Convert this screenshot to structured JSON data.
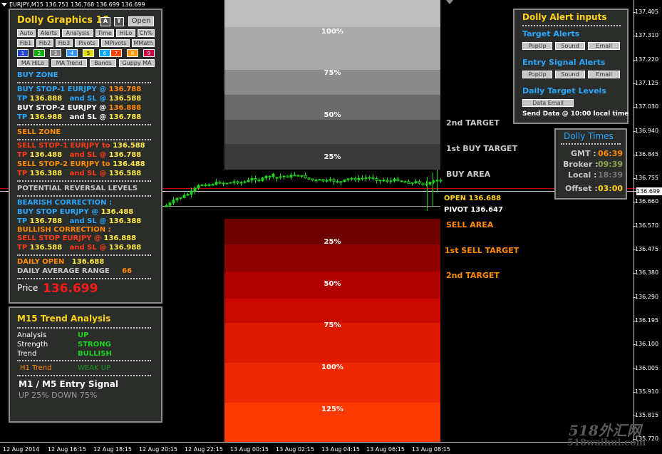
{
  "chart": {
    "title": "EURJPY,M15  136.751 136.768 136.699 136.699",
    "current_price_tag": "136.699",
    "price_ticks": [
      "137.405",
      "137.310",
      "137.220",
      "137.125",
      "137.030",
      "136.940",
      "136.845",
      "136.755",
      "136.660",
      "136.570",
      "136.475",
      "136.380",
      "136.290",
      "136.195",
      "136.100",
      "136.005",
      "135.910",
      "135.815",
      "135.720"
    ],
    "time_ticks": [
      "12 Aug 2014",
      "12 Aug 16:15",
      "12 Aug 18:15",
      "12 Aug 20:15",
      "12 Aug 22:15",
      "13 Aug 00:15",
      "13 Aug 02:15",
      "13 Aug 04:15",
      "13 Aug 06:15",
      "13 Aug 08:15"
    ],
    "grey_zone_labels": [
      "100%",
      "75%",
      "50%",
      "25%"
    ],
    "red_zone_labels": [
      "25%",
      "50%",
      "75%",
      "100%",
      "125%"
    ],
    "side_labels": {
      "second_target_up": "2nd TARGET",
      "first_buy_target": "1st BUY TARGET",
      "buy_area": "BUY AREA",
      "open": "OPEN 136.688",
      "pivot": "PIVOT 136.647",
      "sell_area": "SELL AREA",
      "first_sell_target": "1st SELL TARGET",
      "second_target_down": "2nd TARGET"
    },
    "watermark": "518外汇网",
    "watermark_url": "518waihui.com"
  },
  "main_panel": {
    "title": "Dolly Graphics 16",
    "btn_a": "A",
    "btn_t": "T",
    "btn_open": "Open",
    "row1": [
      "Auto",
      "Alerts",
      "Analysis",
      "Time",
      "HiLo",
      "Ch%"
    ],
    "row2": [
      "Fib1",
      "Fib2",
      "Fib3",
      "Pivots",
      "MPivots",
      "MMath"
    ],
    "row3": [
      "1",
      "2",
      "3",
      "4",
      "5",
      "6",
      "7",
      "8",
      "9"
    ],
    "row4": [
      "MA HiLo",
      "MA Trend",
      "Bands",
      "Guppy MA"
    ],
    "buy_zone": "BUY ZONE",
    "buy_stop1_a": "BUY STOP-1  EURJPY  @",
    "buy_stop1_v": "136.788",
    "tp1_a": "TP",
    "tp1_v": "136.888",
    "tp1_b": "and SL @",
    "tp1_sl": "136.588",
    "buy_stop2_a": "BUY STOP-2  EURJPY  @",
    "buy_stop2_v": "136.888",
    "tp2_a": "TP",
    "tp2_v": "136.988",
    "tp2_b": "and SL @",
    "tp2_sl": "136.788",
    "sell_zone": "SELL ZONE",
    "sell_stop1_a": "SELL STOP-1  EURJPY to",
    "sell_stop1_v": "136.588",
    "stp1_a": "TP",
    "stp1_v": "136.488",
    "stp1_b": "and SL @",
    "stp1_sl": "136.788",
    "sell_stop2_a": "SELL STOP-2  EURJPY to",
    "sell_stop2_v": "136.488",
    "stp2_a": "TP",
    "stp2_v": "136.388",
    "stp2_b": "and SL @",
    "stp2_sl": "136.588",
    "potential": "POTENTIAL REVERSAL LEVELS",
    "bearish": "BEARISH CORRECTION :",
    "bear_stop_a": "BUY STOP EURJPY  @",
    "bear_stop_v": "136.488",
    "bear_tp_a": "TP",
    "bear_tp_v": "136.788",
    "bear_tp_b": "and SL @",
    "bear_tp_sl": "136.388",
    "bullish": "BULLISH CORRECTION :",
    "bull_stop_a": "SELL STOP EURJPY  @",
    "bull_stop_v": "136.888",
    "bull_tp_a": "TP",
    "bull_tp_v": "136.588",
    "bull_tp_b": "and SL @",
    "bull_tp_sl": "136.988",
    "daily_open_a": "DAILY OPEN",
    "daily_open_v": "136.688",
    "dar_a": "DAILY AVERAGE RANGE",
    "dar_v": "66",
    "price_label": "Price",
    "price_value": "136.699"
  },
  "trend_panel": {
    "title": "M15 Trend Analysis",
    "analysis_lbl": "Analysis",
    "analysis_val": "UP",
    "strength_lbl": "Strength",
    "strength_val": "STRONG",
    "trend_lbl": "Trend",
    "trend_val": "BULLISH",
    "h1_lbl": "H1 Trend",
    "h1_val": "WEAK UP",
    "entry_title": "M1 /  M5 Entry Signal",
    "entry_sub": "UP 25%   DOWN 75%"
  },
  "alert_panel": {
    "title": "Dolly Alert inputs",
    "target_alerts": "Target Alerts",
    "entry_alerts": "Entry Signal Alerts",
    "daily_levels": "Daily Target Levels",
    "popup": "PopUp",
    "sound": "Sound",
    "email": "Email",
    "data_email": "Data Email",
    "send_data": "Send Data @ 10:00 local time"
  },
  "times_panel": {
    "title": "Dolly Times",
    "gmt_lbl": "GMT :",
    "gmt_val": "06:39",
    "broker_lbl": "Broker :",
    "broker_val": "09:39",
    "local_lbl": "Local :",
    "local_val": "18:39",
    "offset_lbl": "Offset :",
    "offset_val": "03:00"
  },
  "colors": {
    "gold": "#ffd21a",
    "blue": "#2aa7ff",
    "orange": "#ff8a00",
    "red_text": "#ff3b1a",
    "green": "#1ed21e",
    "yellow_val": "#ffe84a"
  }
}
